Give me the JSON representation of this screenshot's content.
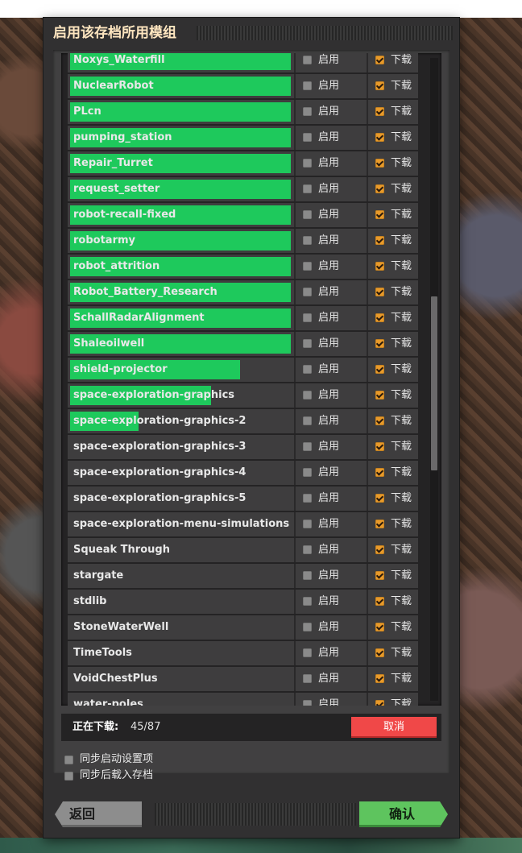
{
  "dialog": {
    "title": "启用该存档所用模组",
    "enable_label": "启用",
    "download_label": "下载",
    "mods": [
      {
        "name": "Noxys_Waterfill",
        "progress": 100,
        "enabled": false,
        "download": true
      },
      {
        "name": "NuclearRobot",
        "progress": 100,
        "enabled": false,
        "download": true
      },
      {
        "name": "PLcn",
        "progress": 100,
        "enabled": false,
        "download": true
      },
      {
        "name": "pumping_station",
        "progress": 100,
        "enabled": false,
        "download": true
      },
      {
        "name": "Repair_Turret",
        "progress": 100,
        "enabled": false,
        "download": true
      },
      {
        "name": "request_setter",
        "progress": 100,
        "enabled": false,
        "download": true
      },
      {
        "name": "robot-recall-fixed",
        "progress": 100,
        "enabled": false,
        "download": true
      },
      {
        "name": "robotarmy",
        "progress": 100,
        "enabled": false,
        "download": true
      },
      {
        "name": "robot_attrition",
        "progress": 100,
        "enabled": false,
        "download": true
      },
      {
        "name": "Robot_Battery_Research",
        "progress": 100,
        "enabled": false,
        "download": true
      },
      {
        "name": "SchallRadarAlignment",
        "progress": 100,
        "enabled": false,
        "download": true
      },
      {
        "name": "Shaleoilwell",
        "progress": 100,
        "enabled": false,
        "download": true
      },
      {
        "name": "shield-projector",
        "progress": 77,
        "enabled": false,
        "download": true
      },
      {
        "name": "space-exploration-graphics",
        "progress": 64,
        "enabled": false,
        "download": true
      },
      {
        "name": "space-exploration-graphics-2",
        "progress": 31,
        "enabled": false,
        "download": true
      },
      {
        "name": "space-exploration-graphics-3",
        "progress": 0,
        "enabled": false,
        "download": true
      },
      {
        "name": "space-exploration-graphics-4",
        "progress": 0,
        "enabled": false,
        "download": true
      },
      {
        "name": "space-exploration-graphics-5",
        "progress": 0,
        "enabled": false,
        "download": true
      },
      {
        "name": "space-exploration-menu-simulations",
        "progress": 0,
        "enabled": false,
        "download": true
      },
      {
        "name": "Squeak Through",
        "progress": 0,
        "enabled": false,
        "download": true
      },
      {
        "name": "stargate",
        "progress": 0,
        "enabled": false,
        "download": true
      },
      {
        "name": "stdlib",
        "progress": 0,
        "enabled": false,
        "download": true
      },
      {
        "name": "StoneWaterWell",
        "progress": 0,
        "enabled": false,
        "download": true
      },
      {
        "name": "TimeTools",
        "progress": 0,
        "enabled": false,
        "download": true
      },
      {
        "name": "VoidChestPlus",
        "progress": 0,
        "enabled": false,
        "download": true
      },
      {
        "name": "water-poles",
        "progress": 0,
        "enabled": false,
        "download": true
      }
    ],
    "status": {
      "label": "正在下载:",
      "count": "45/87",
      "cancel_label": "取消"
    },
    "options": {
      "sync_startup": "同步启动设置项",
      "sync_load": "同步后载入存档"
    },
    "footer": {
      "back_label": "返回",
      "confirm_label": "确认"
    }
  }
}
